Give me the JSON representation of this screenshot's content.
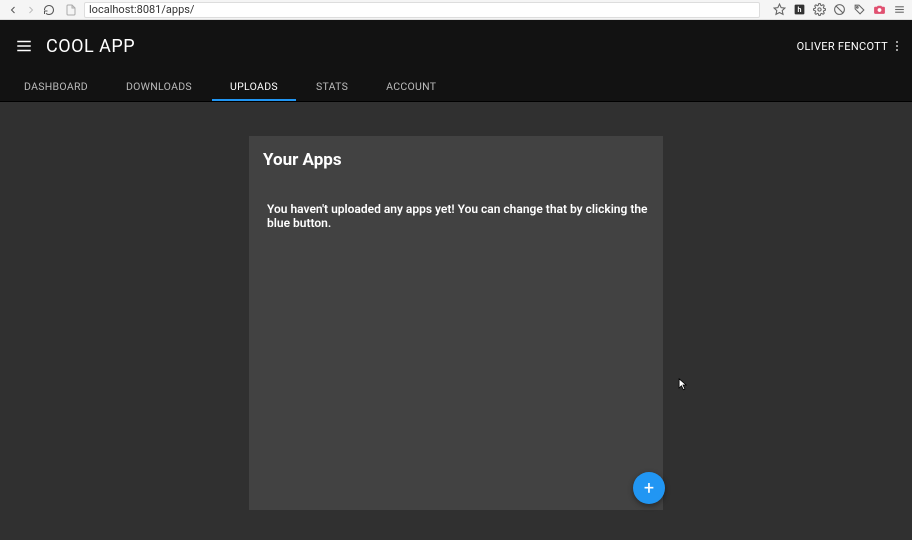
{
  "browser": {
    "url": "localhost:8081/apps/"
  },
  "header": {
    "app_title": "COOL APP",
    "user_name": "OLIVER FENCOTT"
  },
  "tabs": [
    {
      "label": "DASHBOARD",
      "active": false
    },
    {
      "label": "DOWNLOADS",
      "active": false
    },
    {
      "label": "UPLOADS",
      "active": true
    },
    {
      "label": "STATS",
      "active": false
    },
    {
      "label": "ACCOUNT",
      "active": false
    }
  ],
  "card": {
    "title": "Your Apps",
    "body": "You haven't uploaded any apps yet! You can change that by clicking the blue button."
  },
  "colors": {
    "accent": "#2196f3",
    "card_bg": "#424242",
    "app_bg": "#303030",
    "header_bg": "#121212"
  }
}
